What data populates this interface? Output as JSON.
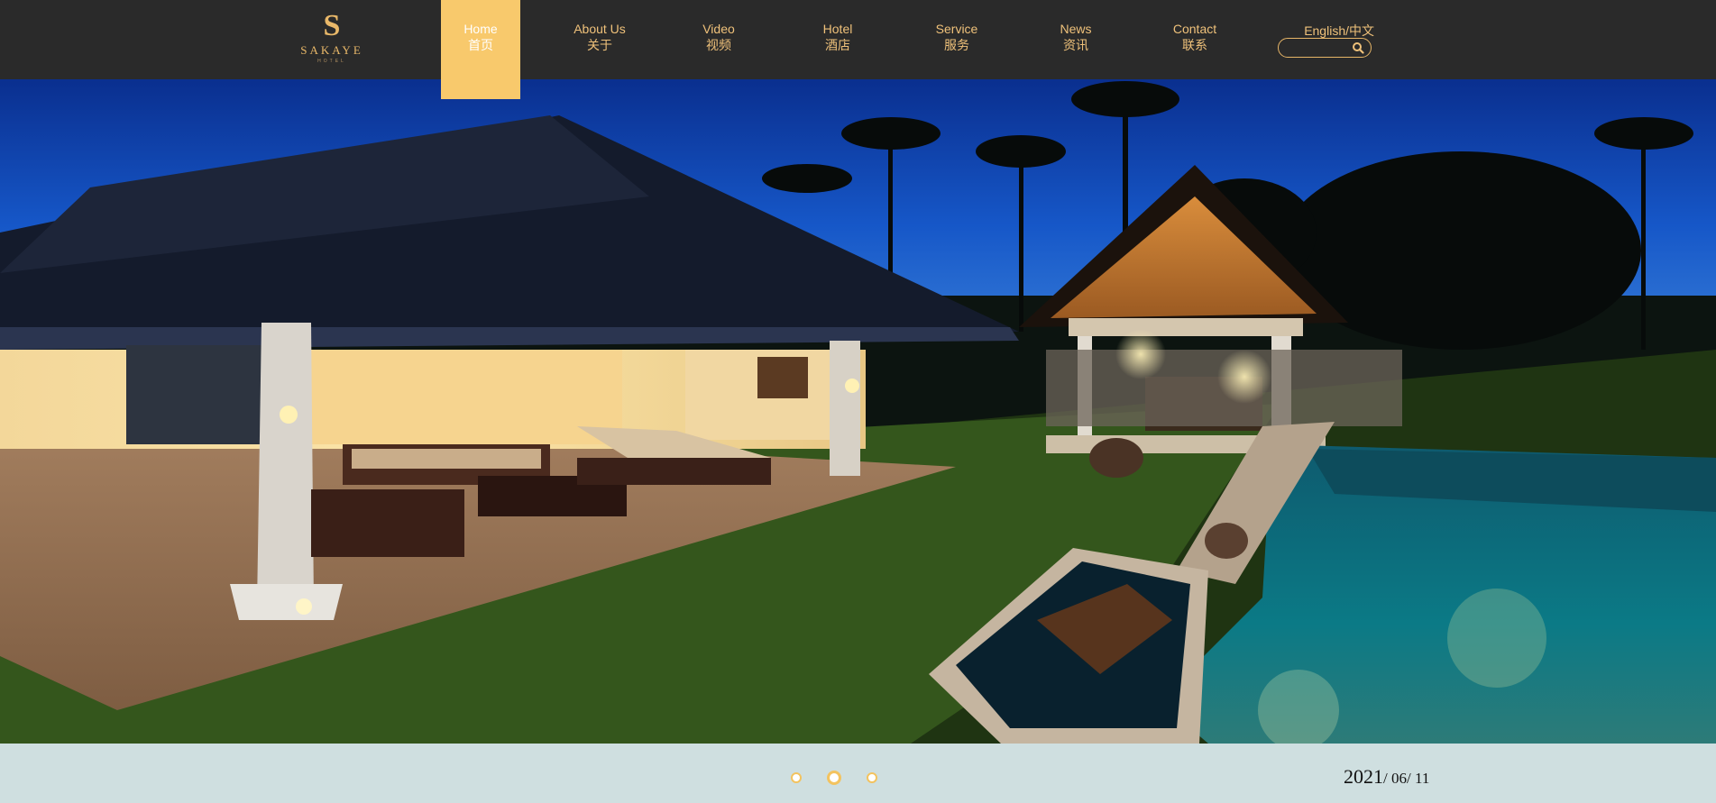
{
  "brand": {
    "logo_letter": "S",
    "name": "SAKAYE",
    "tagline": "HOTEL"
  },
  "nav": {
    "items": [
      {
        "en": "Home",
        "cn": "首页",
        "active": true
      },
      {
        "en": "About Us",
        "cn": "关于",
        "active": false
      },
      {
        "en": "Video",
        "cn": "视频",
        "active": false
      },
      {
        "en": "Hotel",
        "cn": "酒店",
        "active": false
      },
      {
        "en": "Service",
        "cn": "服务",
        "active": false
      },
      {
        "en": "News",
        "cn": "资讯",
        "active": false
      },
      {
        "en": "Contact",
        "cn": "联系",
        "active": false
      }
    ],
    "language_label": "English/中文"
  },
  "search": {
    "placeholder": "",
    "value": "",
    "icon": "search-icon"
  },
  "slider": {
    "dots": [
      {
        "active": false
      },
      {
        "active": true
      },
      {
        "active": false
      }
    ]
  },
  "date": {
    "year": "2021",
    "month_day": "/ 06/ 11"
  },
  "colors": {
    "header_bg": "#2a2a2a",
    "accent_gold": "#efc17a",
    "active_tab_bg": "#f8c96c",
    "footer_bg": "#cfdfe0"
  }
}
